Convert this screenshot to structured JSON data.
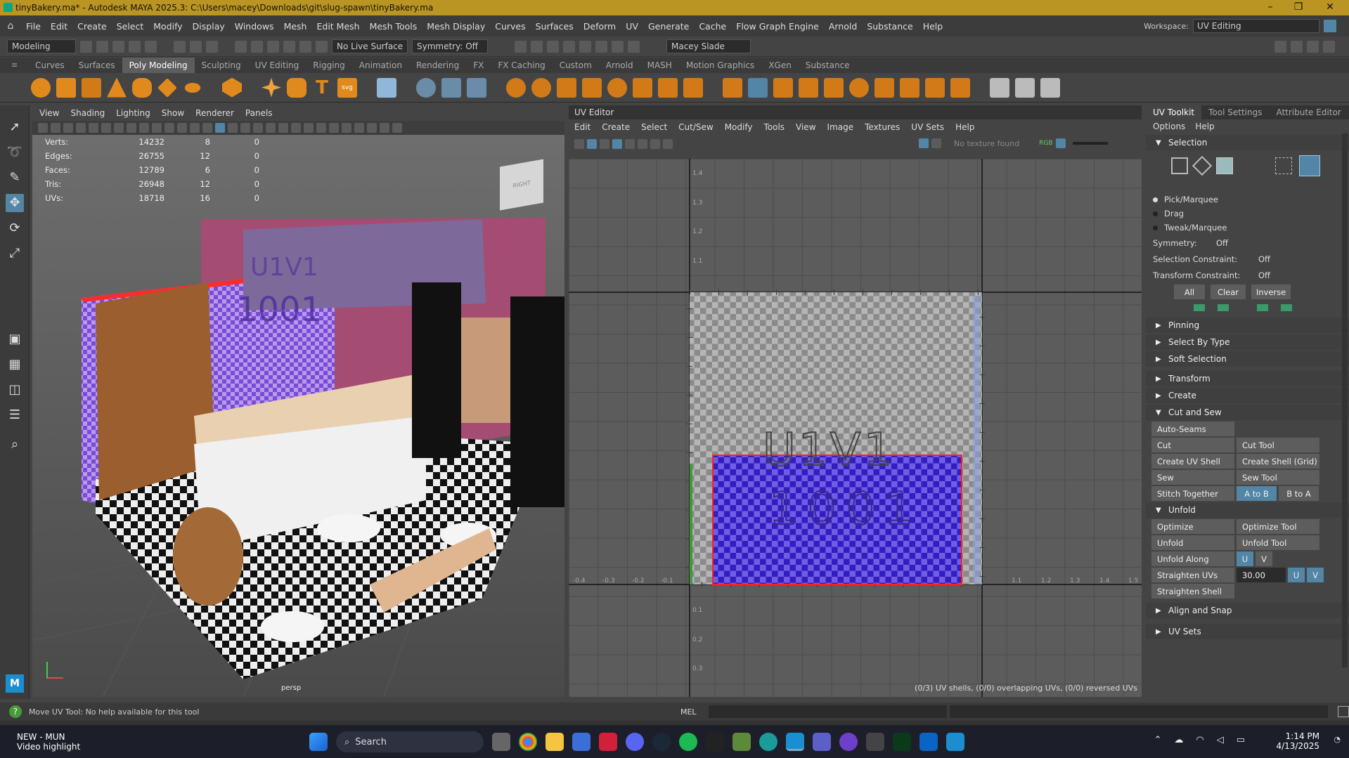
{
  "title": "tinyBakery.ma* - Autodesk MAYA 2025.3: C:\\Users\\macey\\Downloads\\git\\slug-spawn\\tinyBakery.ma",
  "menus": [
    "File",
    "Edit",
    "Create",
    "Select",
    "Modify",
    "Display",
    "Windows",
    "Mesh",
    "Edit Mesh",
    "Mesh Tools",
    "Mesh Display",
    "Curves",
    "Surfaces",
    "Deform",
    "UV",
    "Generate",
    "Cache",
    "Flow Graph Engine",
    "Arnold",
    "Substance",
    "Help"
  ],
  "workspace": {
    "label": "Workspace:",
    "value": "UV Editing"
  },
  "status": {
    "mode": "Modeling",
    "live_surface": "No Live Surface",
    "symmetry": "Symmetry: Off",
    "user": "Macey Slade"
  },
  "shelf_tabs": [
    "Curves",
    "Surfaces",
    "Poly Modeling",
    "Sculpting",
    "UV Editing",
    "Rigging",
    "Animation",
    "Rendering",
    "FX",
    "FX Caching",
    "Custom",
    "Arnold",
    "MASH",
    "Motion Graphics",
    "XGen",
    "Substance"
  ],
  "active_shelf": "Poly Modeling",
  "viewport": {
    "menus": [
      "View",
      "Shading",
      "Lighting",
      "Show",
      "Renderer",
      "Panels"
    ],
    "hud": [
      [
        "Verts:",
        "14232",
        "8",
        "0"
      ],
      [
        "Edges:",
        "26755",
        "12",
        "0"
      ],
      [
        "Faces:",
        "12789",
        "6",
        "0"
      ],
      [
        "Tris:",
        "26948",
        "12",
        "0"
      ],
      [
        "UVs:",
        "18718",
        "16",
        "0"
      ]
    ],
    "camera": "persp",
    "cube_face": "RIGHT",
    "udim_lines": [
      "U1V1",
      "1001"
    ]
  },
  "uv_editor": {
    "title": "UV Editor",
    "menus": [
      "Edit",
      "Create",
      "Select",
      "Cut/Sew",
      "Modify",
      "Tools",
      "View",
      "Image",
      "Textures",
      "UV Sets",
      "Help"
    ],
    "no_texture": "No texture found",
    "rgb": "RGB",
    "udim_lines": [
      "U1V1",
      "1001"
    ],
    "v_labels": [
      "1.4",
      "1.3",
      "1.2",
      "1.1",
      "0.1",
      "0.2",
      "0.3"
    ],
    "u_labels": [
      "-0.4",
      "-0.3",
      "-0.2",
      "-0.1",
      "1.1",
      "1.2",
      "1.3",
      "1.4",
      "1.5"
    ],
    "status": "(0/3) UV shells, (0/0) overlapping UVs, (0/0) reversed UVs"
  },
  "toolkit": {
    "tabs": [
      "UV Toolkit",
      "Tool Settings",
      "Attribute Editor"
    ],
    "menus": [
      "Options",
      "Help"
    ],
    "selection": "Selection",
    "radios": [
      "Pick/Marquee",
      "Drag",
      "Tweak/Marquee"
    ],
    "symmetry": [
      "Symmetry:",
      "Off"
    ],
    "sel_constraint": [
      "Selection Constraint:",
      "Off"
    ],
    "xf_constraint": [
      "Transform Constraint:",
      "Off"
    ],
    "sel_buttons": [
      "All",
      "Clear",
      "Inverse"
    ],
    "collapsed1": [
      "Pinning",
      "Select By Type",
      "Soft Selection"
    ],
    "collapsed2": [
      "Transform",
      "Create"
    ],
    "cut_sew": "Cut and Sew",
    "auto_seams": "Auto-Seams",
    "cs_rows": [
      [
        "Cut",
        "Cut Tool"
      ],
      [
        "Create UV Shell",
        "Create Shell (Grid)"
      ],
      [
        "Sew",
        "Sew Tool"
      ]
    ],
    "stitch": [
      "Stitch Together",
      "A to B",
      "B to A"
    ],
    "unfold": "Unfold",
    "unfold_rows": [
      [
        "Optimize",
        "Optimize Tool"
      ],
      [
        "Unfold",
        "Unfold Tool"
      ]
    ],
    "unfold_along": [
      "Unfold Along",
      "U",
      "V"
    ],
    "straighten": [
      "Straighten UVs",
      "30.00",
      "U",
      "V"
    ],
    "straighten_shell": "Straighten Shell",
    "align": "Align and Snap",
    "uvsets": "UV Sets"
  },
  "cmd": {
    "help": "Move UV Tool: No help available for this tool",
    "mel": "MEL"
  },
  "taskbar": {
    "news_title": "NEW - MUN",
    "news_sub": "Video highlight",
    "search": "Search",
    "time": "1:14 PM",
    "date": "4/13/2025"
  },
  "colors": {
    "title": "#ba9524",
    "accent": "#5285a6",
    "shell_fill": "#3a1fd0",
    "shell_border": "#ff2020"
  }
}
